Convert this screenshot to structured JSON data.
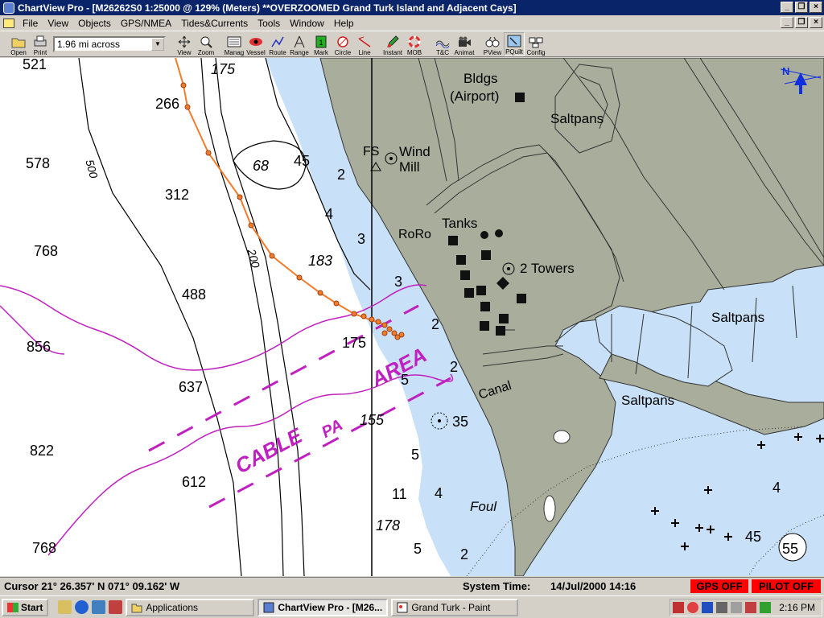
{
  "window": {
    "title": "ChartView Pro - [M26262S0 1:25000 @ 129% (Meters) **OVERZOOMED Grand Turk Island and Adjacent Cays]"
  },
  "menu": {
    "items": [
      "File",
      "View",
      "Objects",
      "GPS/NMEA",
      "Tides&Currents",
      "Tools",
      "Window",
      "Help"
    ]
  },
  "toolbar": {
    "open": "Open",
    "print": "Print",
    "zoom_value": "1.96 mi across",
    "view": "View",
    "zoom": "Zoom",
    "manage": "Manag",
    "vessel": "Vessel",
    "route": "Route",
    "range": "Range",
    "mark": "Mark",
    "circle": "Circle",
    "line": "Line",
    "instant": "Instant",
    "mob": "MOB",
    "tc": "T&C",
    "animate": "Animat",
    "pview": "PView",
    "pquilt": "PQuilt",
    "config": "Config"
  },
  "chart_labels": {
    "depths": [
      "521",
      "175",
      "266",
      "578",
      "500",
      "312",
      "68",
      "45",
      "2",
      "768",
      "4",
      "3",
      "183",
      "488",
      "200",
      "3",
      "856",
      "175",
      "2",
      "637",
      "2",
      "5",
      "822",
      "155",
      "35",
      "612",
      "5",
      "4",
      "11",
      "178",
      "768",
      "5",
      "2",
      "4",
      "45",
      "55"
    ],
    "features": [
      "Bldgs",
      "(Airport)",
      "Saltpans",
      "FS",
      "Wind",
      "Mill",
      "RoRo",
      "Tanks",
      "2 Towers",
      "Saltpans",
      "Canal",
      "Saltpans",
      "Foul",
      "CABLE",
      "AREA",
      "PA",
      "N"
    ]
  },
  "status": {
    "cursor": "Cursor 21° 26.357' N  071° 09.162' W",
    "time_label": "System Time:",
    "time_value": "14/Jul/2000  14:16",
    "gps": "GPS OFF",
    "pilot": "PILOT OFF"
  },
  "taskbar": {
    "start": "Start",
    "tasks": [
      "Applications",
      "ChartView Pro - [M26...",
      "Grand Turk - Paint"
    ],
    "clock": "2:16 PM"
  },
  "colors": {
    "land": "#a9ae9c",
    "shallow": "#c8e1f8",
    "cable": "#c020c0",
    "route": "#f07c2c",
    "gps_off": "#ff0000"
  }
}
